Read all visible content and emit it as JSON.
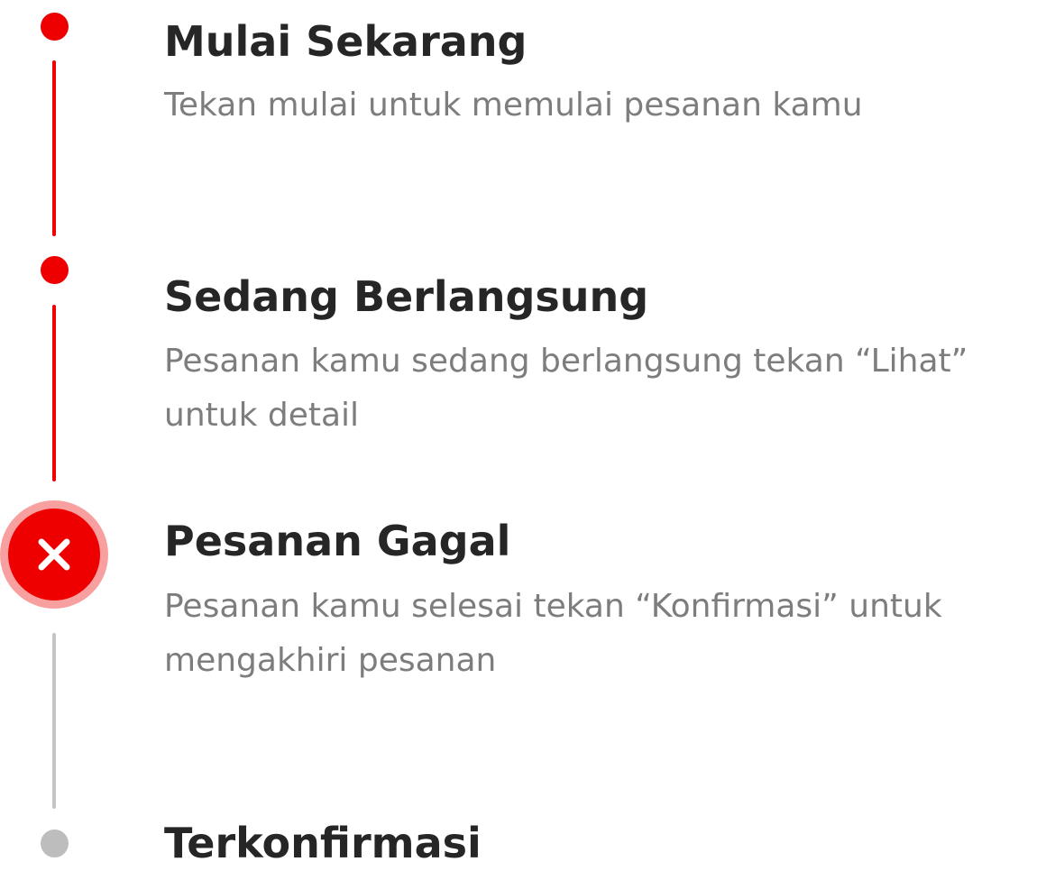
{
  "steps": [
    {
      "title": "Mulai Sekarang",
      "description": "Tekan mulai untuk memulai pesanan kamu",
      "status": "done"
    },
    {
      "title": "Sedang Berlangsung",
      "description": "Pesanan kamu sedang berlangsung tekan “Lihat” untuk detail",
      "status": "done"
    },
    {
      "title": "Pesanan Gagal",
      "description": "Pesanan kamu selesai tekan “Konfirmasi” untuk mengakhiri pesanan",
      "status": "failed",
      "icon": "close-icon"
    },
    {
      "title": "Terkonfirmasi",
      "description": "",
      "status": "pending"
    }
  ],
  "colors": {
    "accent": "#ee0000",
    "accent_ring": "#f8a0a0",
    "pending": "#bdbdbd",
    "title": "#262626",
    "description": "#7d7d7d"
  }
}
